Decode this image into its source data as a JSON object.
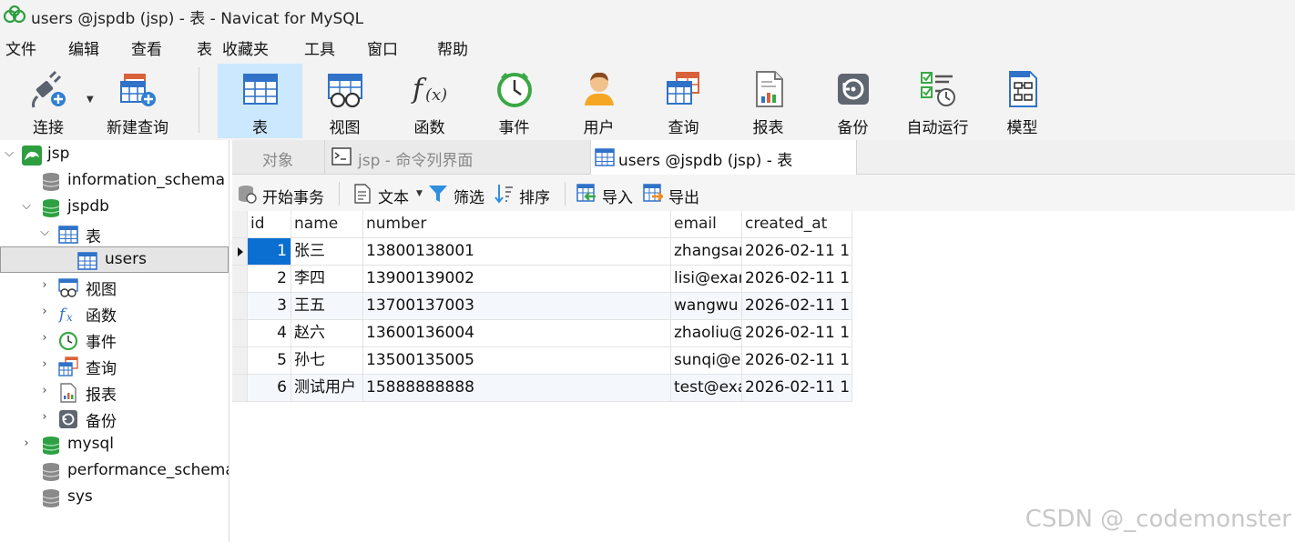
{
  "window": {
    "title": "users @jspdb (jsp) - 表 - Navicat for MySQL"
  },
  "menu": [
    "文件",
    "编辑",
    "查看",
    "表",
    "收藏夹",
    "工具",
    "窗口",
    "帮助"
  ],
  "toolbar": {
    "connect": "连接",
    "new_query": "新建查询",
    "table": "表",
    "view": "视图",
    "function": "函数",
    "event": "事件",
    "user": "用户",
    "query": "查询",
    "report": "报表",
    "backup": "备份",
    "automation": "自动运行",
    "model": "模型"
  },
  "sidebar": {
    "connection": "jsp",
    "db_information_schema": "information_schema",
    "db_jspdb": "jspdb",
    "group_tables": "表",
    "table_users": "users",
    "group_views": "视图",
    "group_functions": "函数",
    "group_events": "事件",
    "group_queries": "查询",
    "group_reports": "报表",
    "group_backups": "备份",
    "db_mysql": "mysql",
    "db_performance_schema": "performance_schema",
    "db_sys": "sys"
  },
  "tabs": {
    "objects": "对象",
    "console": "jsp - 命令列界面",
    "table": "users @jspdb (jsp) - 表"
  },
  "table_toolbar": {
    "begin_transaction": "开始事务",
    "text": "文本",
    "filter": "筛选",
    "sort": "排序",
    "import": "导入",
    "export": "导出"
  },
  "grid": {
    "columns": [
      "id",
      "name",
      "number",
      "email",
      "created_at"
    ],
    "rows": [
      [
        "1",
        "张三",
        "13800138001",
        "zhangsan",
        "2026-02-11 1"
      ],
      [
        "2",
        "李四",
        "13900139002",
        "lisi@exar",
        "2026-02-11 1"
      ],
      [
        "3",
        "王五",
        "13700137003",
        "wangwu",
        "2026-02-11 1"
      ],
      [
        "4",
        "赵六",
        "13600136004",
        "zhaoliu@",
        "2026-02-11 1"
      ],
      [
        "5",
        "孙七",
        "13500135005",
        "sunqi@e",
        "2026-02-11 1"
      ],
      [
        "6",
        "测试用户",
        "15888888888",
        "test@exa",
        "2026-02-11 1"
      ]
    ]
  },
  "watermark": "CSDN @_codemonster"
}
